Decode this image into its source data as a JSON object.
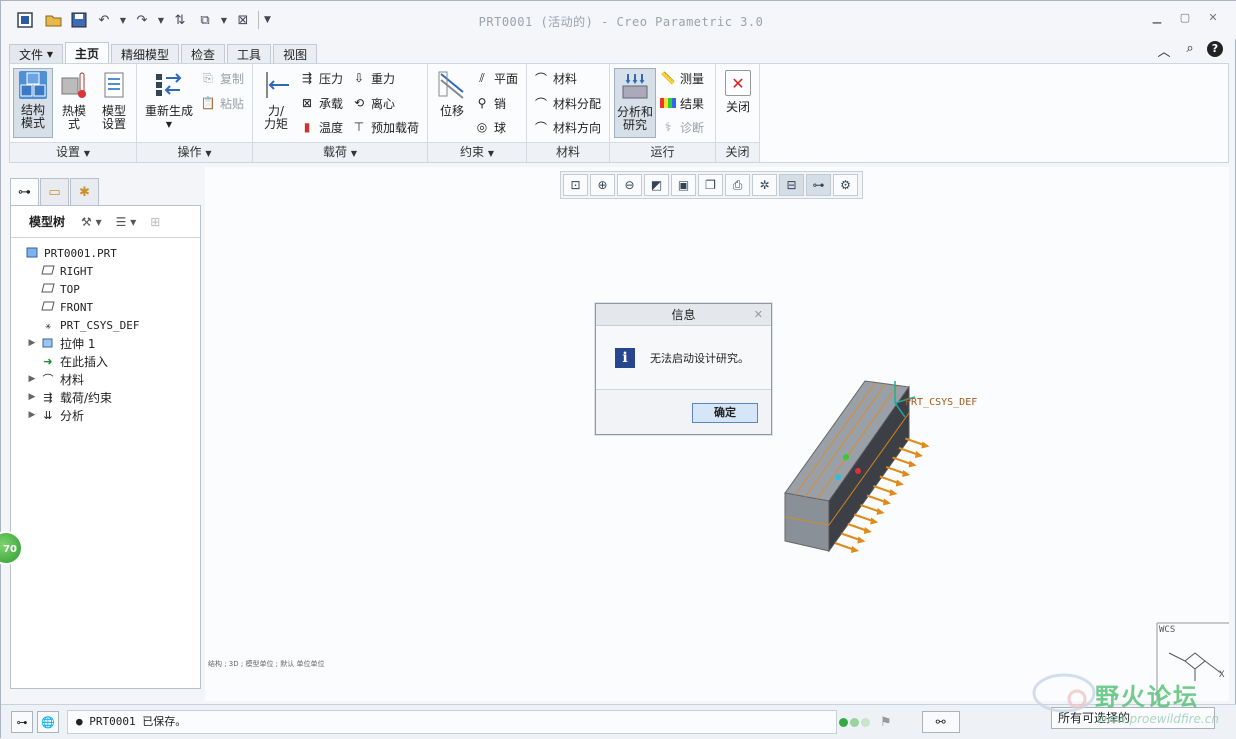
{
  "window": {
    "title": "PRT0001 (活动的) - Creo Parametric 3.0"
  },
  "menu_tabs": [
    "文件",
    "主页",
    "精细模型",
    "检查",
    "工具",
    "视图"
  ],
  "ribbon": {
    "setup": {
      "label": "设置",
      "buttons": [
        "结构\n模式",
        "热模\n式",
        "模型\n设置"
      ]
    },
    "operations": {
      "label": "操作",
      "regenerate": "重新生成",
      "copy": "复制",
      "paste": "粘贴"
    },
    "loads": {
      "label": "载荷",
      "force": "力/\n力矩",
      "pressure": "压力",
      "bearing": "承载",
      "temperature": "温度",
      "gravity": "重力",
      "centrifugal": "离心",
      "preload": "预加载荷"
    },
    "constraints": {
      "label": "约束",
      "displacement": "位移",
      "plane": "平面",
      "pin": "销",
      "ball": "球"
    },
    "materials": {
      "label": "材料",
      "material": "材料",
      "assignment": "材料分配",
      "orientation": "材料方向"
    },
    "run": {
      "label": "运行",
      "analysis": "分析和\n研究",
      "measure": "测量",
      "results": "结果",
      "diagnostics": "诊断"
    },
    "close": {
      "label": "关闭",
      "button": "关闭"
    }
  },
  "model_tree": {
    "header": "模型树",
    "items": [
      {
        "label": "PRT0001.PRT",
        "icon": "part-icon",
        "expandable": false,
        "indent": 0
      },
      {
        "label": "RIGHT",
        "icon": "datum-plane-icon",
        "expandable": false,
        "indent": 1
      },
      {
        "label": "TOP",
        "icon": "datum-plane-icon",
        "expandable": false,
        "indent": 1
      },
      {
        "label": "FRONT",
        "icon": "datum-plane-icon",
        "expandable": false,
        "indent": 1
      },
      {
        "label": "PRT_CSYS_DEF",
        "icon": "csys-icon",
        "expandable": false,
        "indent": 1
      },
      {
        "label": "拉伸 1",
        "icon": "extrude-icon",
        "expandable": true,
        "indent": 1
      },
      {
        "label": "在此插入",
        "icon": "insert-here-icon",
        "expandable": false,
        "indent": 1
      },
      {
        "label": "材料",
        "icon": "material-icon",
        "expandable": true,
        "indent": 1
      },
      {
        "label": "载荷/约束",
        "icon": "loads-icon",
        "expandable": true,
        "indent": 1
      },
      {
        "label": "分析",
        "icon": "analysis-icon",
        "expandable": true,
        "indent": 1
      }
    ]
  },
  "graphics": {
    "csys_label": "PRT_CSYS_DEF",
    "view_status": "结构 ; 3D ; 模型单位 ; 默认 单位单位",
    "wcs_label": "WCS",
    "axis_x": "X"
  },
  "dialog": {
    "title": "信息",
    "message": "无法启动设计研究。",
    "ok": "确定"
  },
  "statusbar": {
    "message": "● PRT0001 已保存。",
    "filter": "所有可选择的"
  },
  "overlay": {
    "badge": "70",
    "watermark": "野火论坛",
    "watermark_url": "www.proewildfire.cn"
  },
  "colors": {
    "accent": "#28468f",
    "dialog_button": "#d5e6f8",
    "load_arrow": "#e08a1a",
    "status_green": "#33aa44"
  }
}
